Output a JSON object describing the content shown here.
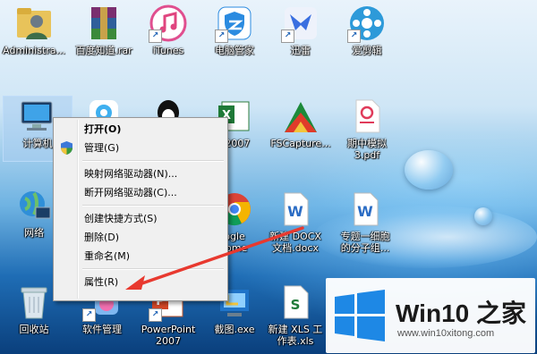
{
  "desktop": {
    "icons": [
      {
        "name": "administrator-folder",
        "label": "Administra..."
      },
      {
        "name": "baidu-rar",
        "label": "百度知道.rar"
      },
      {
        "name": "itunes",
        "label": "iTunes"
      },
      {
        "name": "pc-manager",
        "label": "电脑管家"
      },
      {
        "name": "xunlei",
        "label": "迅雷"
      },
      {
        "name": "aijianji",
        "label": "爱剪辑"
      },
      {
        "name": "computer",
        "label": "计算机"
      },
      {
        "name": "excel-2007",
        "label": "l 2007"
      },
      {
        "name": "fscapture",
        "label": "FSCapture..."
      },
      {
        "name": "qimo-pdf",
        "label": "期中模拟\n3.pdf"
      },
      {
        "name": "network",
        "label": "网络"
      },
      {
        "name": "chrome",
        "label": "ogle\nrome"
      },
      {
        "name": "new-docx",
        "label": "新建 DOCX\n文档.docx"
      },
      {
        "name": "special-docx",
        "label": "专题一细胞\n的分子组..."
      },
      {
        "name": "recycle-bin",
        "label": "回收站"
      },
      {
        "name": "software-mgmt",
        "label": "软件管理"
      },
      {
        "name": "powerpoint",
        "label": "PowerPoint\n2007"
      },
      {
        "name": "screenshot-exe",
        "label": "截图.exe"
      },
      {
        "name": "new-xls",
        "label": "新建 XLS 工\n作表.xls"
      }
    ]
  },
  "context_menu": {
    "items": [
      {
        "name": "open",
        "label": "打开(O)",
        "bold": true
      },
      {
        "name": "manage",
        "label": "管理(G)",
        "shield": true
      },
      {
        "sep": true
      },
      {
        "name": "map-drive",
        "label": "映射网络驱动器(N)..."
      },
      {
        "name": "disconnect-drive",
        "label": "断开网络驱动器(C)..."
      },
      {
        "sep": true
      },
      {
        "name": "create-shortcut",
        "label": "创建快捷方式(S)"
      },
      {
        "name": "delete",
        "label": "删除(D)"
      },
      {
        "name": "rename",
        "label": "重命名(M)"
      },
      {
        "sep": true
      },
      {
        "name": "properties",
        "label": "属性(R)"
      }
    ]
  },
  "watermark": {
    "brand": "Win10 之家",
    "url": "www.win10xitong.com",
    "arrow_color": "#e8392f"
  }
}
